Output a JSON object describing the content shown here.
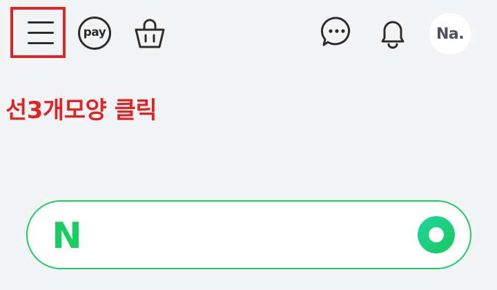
{
  "header": {
    "menu_icon": "hamburger-menu-icon",
    "pay_label": "pay",
    "shopping_icon": "shopping-bag-icon",
    "talk_icon": "chat-bubble-icon",
    "notification_icon": "bell-icon",
    "avatar_text": "Na."
  },
  "annotation": {
    "text": "선3개모양 클릭",
    "color": "#e02424"
  },
  "search": {
    "logo_text": "N",
    "logo_color": "#19ce60",
    "button_icon": "green-circle-icon",
    "border_color": "#19ce60"
  }
}
